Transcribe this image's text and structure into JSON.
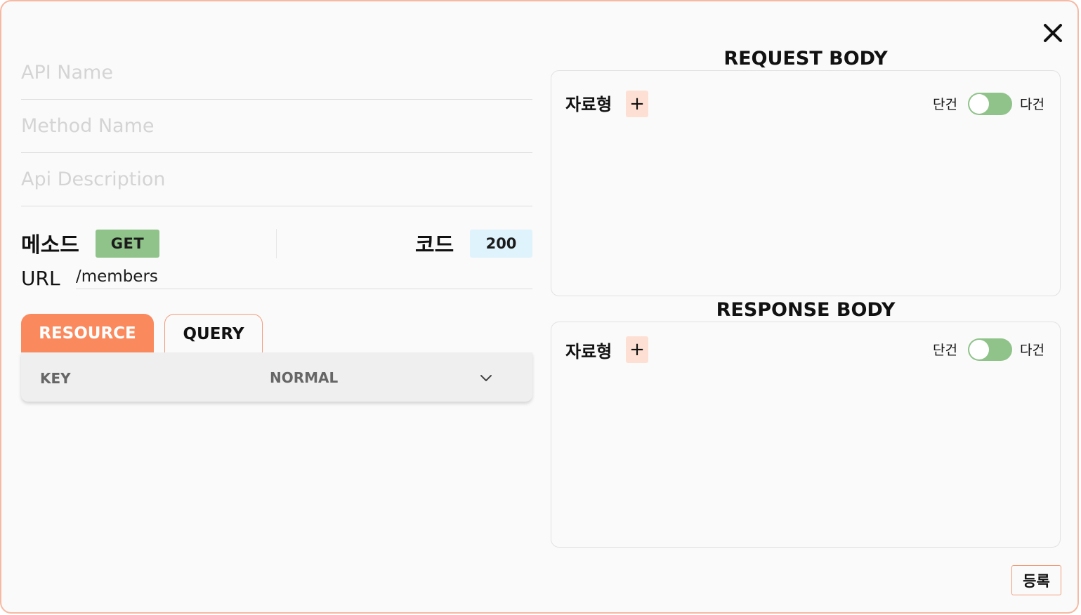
{
  "close": {
    "icon": "close-icon"
  },
  "form": {
    "api_name": {
      "value": "",
      "placeholder": "API Name"
    },
    "method_name": {
      "value": "",
      "placeholder": "Method Name"
    },
    "api_description": {
      "value": "",
      "placeholder": "Api Description"
    }
  },
  "method": {
    "label": "메소드",
    "value": "GET",
    "color": "#8fc38a"
  },
  "code": {
    "label": "코드",
    "value": "200",
    "color": "#dff3fc"
  },
  "url": {
    "label": "URL",
    "value": "/members"
  },
  "tabs": [
    {
      "label": "RESOURCE",
      "active": true
    },
    {
      "label": "QUERY",
      "active": false
    }
  ],
  "params": [
    {
      "key": "KEY",
      "type": "NORMAL",
      "dropdown_icon": "chevron-down-icon"
    }
  ],
  "request_body": {
    "title": "REQUEST BODY",
    "type_label": "자료형",
    "add_label": "+",
    "toggle_left": "단건",
    "toggle_right": "다건"
  },
  "response_body": {
    "title": "RESPONSE BODY",
    "type_label": "자료형",
    "add_label": "+",
    "toggle_left": "단건",
    "toggle_right": "다건"
  },
  "submit": {
    "label": "등록"
  },
  "colors": {
    "accent": "#fa8a5e",
    "toggle_on": "#8fc38a",
    "border": "#f6b9a3"
  }
}
